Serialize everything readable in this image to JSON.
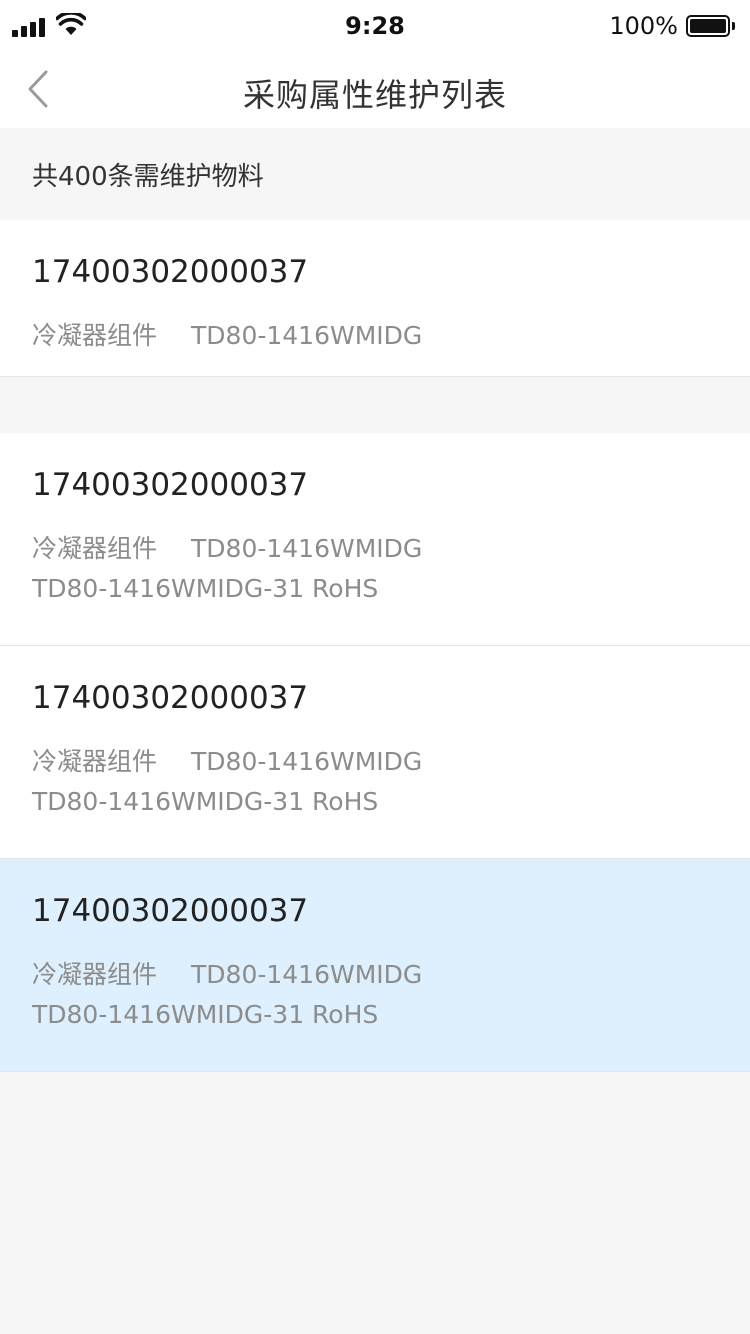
{
  "status_bar": {
    "time": "9:28",
    "battery_percent": "100%"
  },
  "nav": {
    "title": "采购属性维护列表",
    "back_icon": "chevron-left-icon"
  },
  "summary": {
    "text": "共400条需维护物料"
  },
  "items": [
    {
      "code": "17400302000037",
      "name": "冷凝器组件",
      "model": "TD80-1416WMIDG",
      "spec": ""
    },
    {
      "code": "17400302000037",
      "name": "冷凝器组件",
      "model": "TD80-1416WMIDG",
      "spec": "TD80-1416WMIDG-31 RoHS"
    },
    {
      "code": "17400302000037",
      "name": "冷凝器组件",
      "model": "TD80-1416WMIDG",
      "spec": "TD80-1416WMIDG-31 RoHS"
    },
    {
      "code": "17400302000037",
      "name": "冷凝器组件",
      "model": "TD80-1416WMIDG",
      "spec": "TD80-1416WMIDG-31 RoHS",
      "selected": true
    }
  ],
  "colors": {
    "selected_row": "#def0fd",
    "background": "#f6f6f6"
  }
}
